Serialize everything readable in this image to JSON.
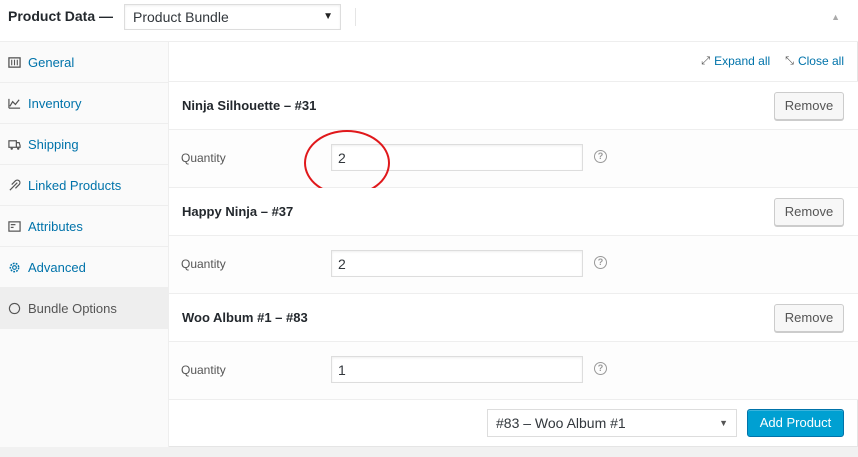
{
  "header": {
    "title": "Product Data —",
    "product_type": "Product Bundle"
  },
  "sidebar": {
    "items": [
      {
        "label": "General",
        "icon": "general-icon"
      },
      {
        "label": "Inventory",
        "icon": "inventory-icon"
      },
      {
        "label": "Shipping",
        "icon": "shipping-icon"
      },
      {
        "label": "Linked Products",
        "icon": "link-icon"
      },
      {
        "label": "Attributes",
        "icon": "attributes-icon"
      },
      {
        "label": "Advanced",
        "icon": "gear-icon"
      },
      {
        "label": "Bundle Options",
        "icon": "bundle-icon"
      }
    ],
    "active_index": 6
  },
  "toolbar": {
    "expand_all": "Expand all",
    "close_all": "Close all"
  },
  "items": [
    {
      "title": "Ninja Silhouette – #31",
      "remove_label": "Remove",
      "quantity_label": "Quantity",
      "quantity": "2"
    },
    {
      "title": "Happy Ninja – #37",
      "remove_label": "Remove",
      "quantity_label": "Quantity",
      "quantity": "2"
    },
    {
      "title": "Woo Album #1 – #83",
      "remove_label": "Remove",
      "quantity_label": "Quantity",
      "quantity": "1"
    }
  ],
  "footer": {
    "selected_product": "#83 – Woo Album #1",
    "add_button": "Add Product"
  },
  "colors": {
    "link": "#0073aa",
    "primary_button": "#00a0d2",
    "annotation_circle": "#e0181b"
  }
}
